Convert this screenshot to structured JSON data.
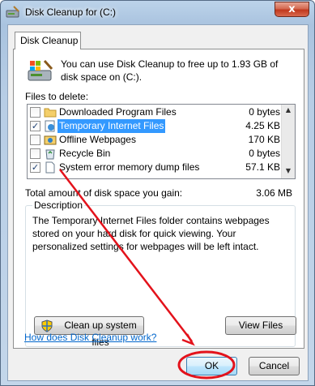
{
  "window": {
    "title": "Disk Cleanup for  (C:)",
    "close_label": "x"
  },
  "tab": {
    "label": "Disk Cleanup"
  },
  "info": {
    "text": "You can use Disk Cleanup to free up to 1.93 GB of disk space on  (C:)."
  },
  "files": {
    "label": "Files to delete:",
    "items": [
      {
        "name": "Downloaded Program Files",
        "size": "0 bytes",
        "checked": false,
        "icon": "folder-icon"
      },
      {
        "name": "Temporary Internet Files",
        "size": "4.25 KB",
        "checked": true,
        "selected": true,
        "icon": "internet-files-icon"
      },
      {
        "name": "Offline Webpages",
        "size": "170 KB",
        "checked": false,
        "icon": "offline-webpages-icon"
      },
      {
        "name": "Recycle Bin",
        "size": "0 bytes",
        "checked": false,
        "icon": "recycle-bin-icon"
      },
      {
        "name": "System error memory dump files",
        "size": "57.1 KB",
        "checked": true,
        "icon": "document-icon"
      }
    ]
  },
  "total": {
    "label": "Total amount of disk space you gain:",
    "value": "3.06 MB"
  },
  "description": {
    "title": "Description",
    "text": "The Temporary Internet Files folder contains webpages stored on your hard disk for quick viewing. Your personalized settings for webpages will be left intact."
  },
  "buttons": {
    "cleanup_label": "Clean up system files",
    "view_files_label": "View Files",
    "ok_label": "OK",
    "cancel_label": "Cancel"
  },
  "help_link": "How does Disk Cleanup work?",
  "colors": {
    "annotation": "#e3121b",
    "selection": "#3399ff",
    "link": "#0066cc"
  }
}
